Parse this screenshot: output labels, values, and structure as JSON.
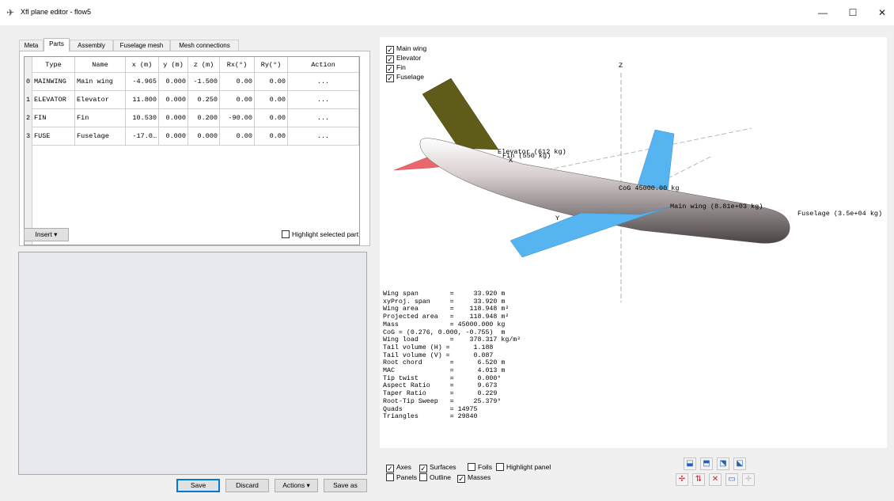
{
  "window": {
    "title": "Xfl plane editor - flow5",
    "minimize": "—",
    "maximize": "☐",
    "close": "✕"
  },
  "tabs": [
    "Meta",
    "Parts",
    "Assembly",
    "Fuselage mesh",
    "Mesh connections"
  ],
  "active_tab": "Parts",
  "parts_table": {
    "headers": [
      "Type",
      "Name",
      "x (m)",
      "y (m)",
      "z (m)",
      "Rx(°)",
      "Ry(°)",
      "Action"
    ],
    "rows": [
      {
        "index": "0",
        "type": "MAINWING",
        "name": "Main wing",
        "x": "-4.965",
        "y": "0.000",
        "z": "-1.500",
        "rx": "0.00",
        "ry": "0.00",
        "action": "..."
      },
      {
        "index": "1",
        "type": "ELEVATOR",
        "name": "Elevator",
        "x": "11.800",
        "y": "0.000",
        "z": "0.250",
        "rx": "0.00",
        "ry": "0.00",
        "action": "..."
      },
      {
        "index": "2",
        "type": "FIN",
        "name": "Fin",
        "x": "10.530",
        "y": "0.000",
        "z": "0.200",
        "rx": "-90.00",
        "ry": "0.00",
        "action": "..."
      },
      {
        "index": "3",
        "type": "FUSE",
        "name": "Fuselage",
        "x": "-17.0…",
        "y": "0.000",
        "z": "0.000",
        "rx": "0.00",
        "ry": "0.00",
        "action": "..."
      }
    ]
  },
  "insert_button": "Insert",
  "highlight_selected_part": "Highlight selected part",
  "bottom_buttons": {
    "save": "Save",
    "discard": "Discard",
    "actions": "Actions",
    "save_as": "Save as"
  },
  "view_checks": {
    "main_wing": "Main wing",
    "elevator": "Elevator",
    "fin": "Fin",
    "fuselage": "Fuselage"
  },
  "view_labels": {
    "z_axis": "Z",
    "x_axis": "X",
    "y_axis": "Y",
    "elevator_mass": "Elevator (612 kg)",
    "fin_mass": "Fin (550 kg)",
    "cog": "CoG 45000.00 kg",
    "main_wing_mass": "Main wing (8.81e+03 kg)",
    "fuselage_mass": "Fuselage (3.5e+04 kg)"
  },
  "plane_info": [
    "Wing span        =     33.920 m",
    "xyProj. span     =     33.920 m",
    "Wing area        =    118.948 m²",
    "Projected area   =    118.948 m²",
    "Mass             = 45000.000 kg",
    "CoG = (0.276, 0.000, -0.755)  m",
    "Wing load        =    378.317 kg/m²",
    "Tail volume (H) =      1.188",
    "Tail volume (V) =      0.087",
    "Root chord       =      6.520 m",
    "MAC              =      4.013 m",
    "Tip twist        =      0.000°",
    "Aspect Ratio     =      9.673",
    "Taper Ratio      =      0.229",
    "Root-Tip Sweep   =     25.379°",
    "Quads            = 14975",
    "Triangles        = 29840"
  ],
  "display_options": {
    "axes": "Axes",
    "surfaces": "Surfaces",
    "foils": "Foils",
    "highlight_panel": "Highlight panel",
    "panels": "Panels",
    "outline": "Outline",
    "masses": "Masses"
  },
  "colors": {
    "wing": "#56b4f0",
    "elevator": "#e8686e",
    "fin": "#5f5c1a",
    "fuselage": "#c8c0c0",
    "accent": "#0078d7"
  }
}
